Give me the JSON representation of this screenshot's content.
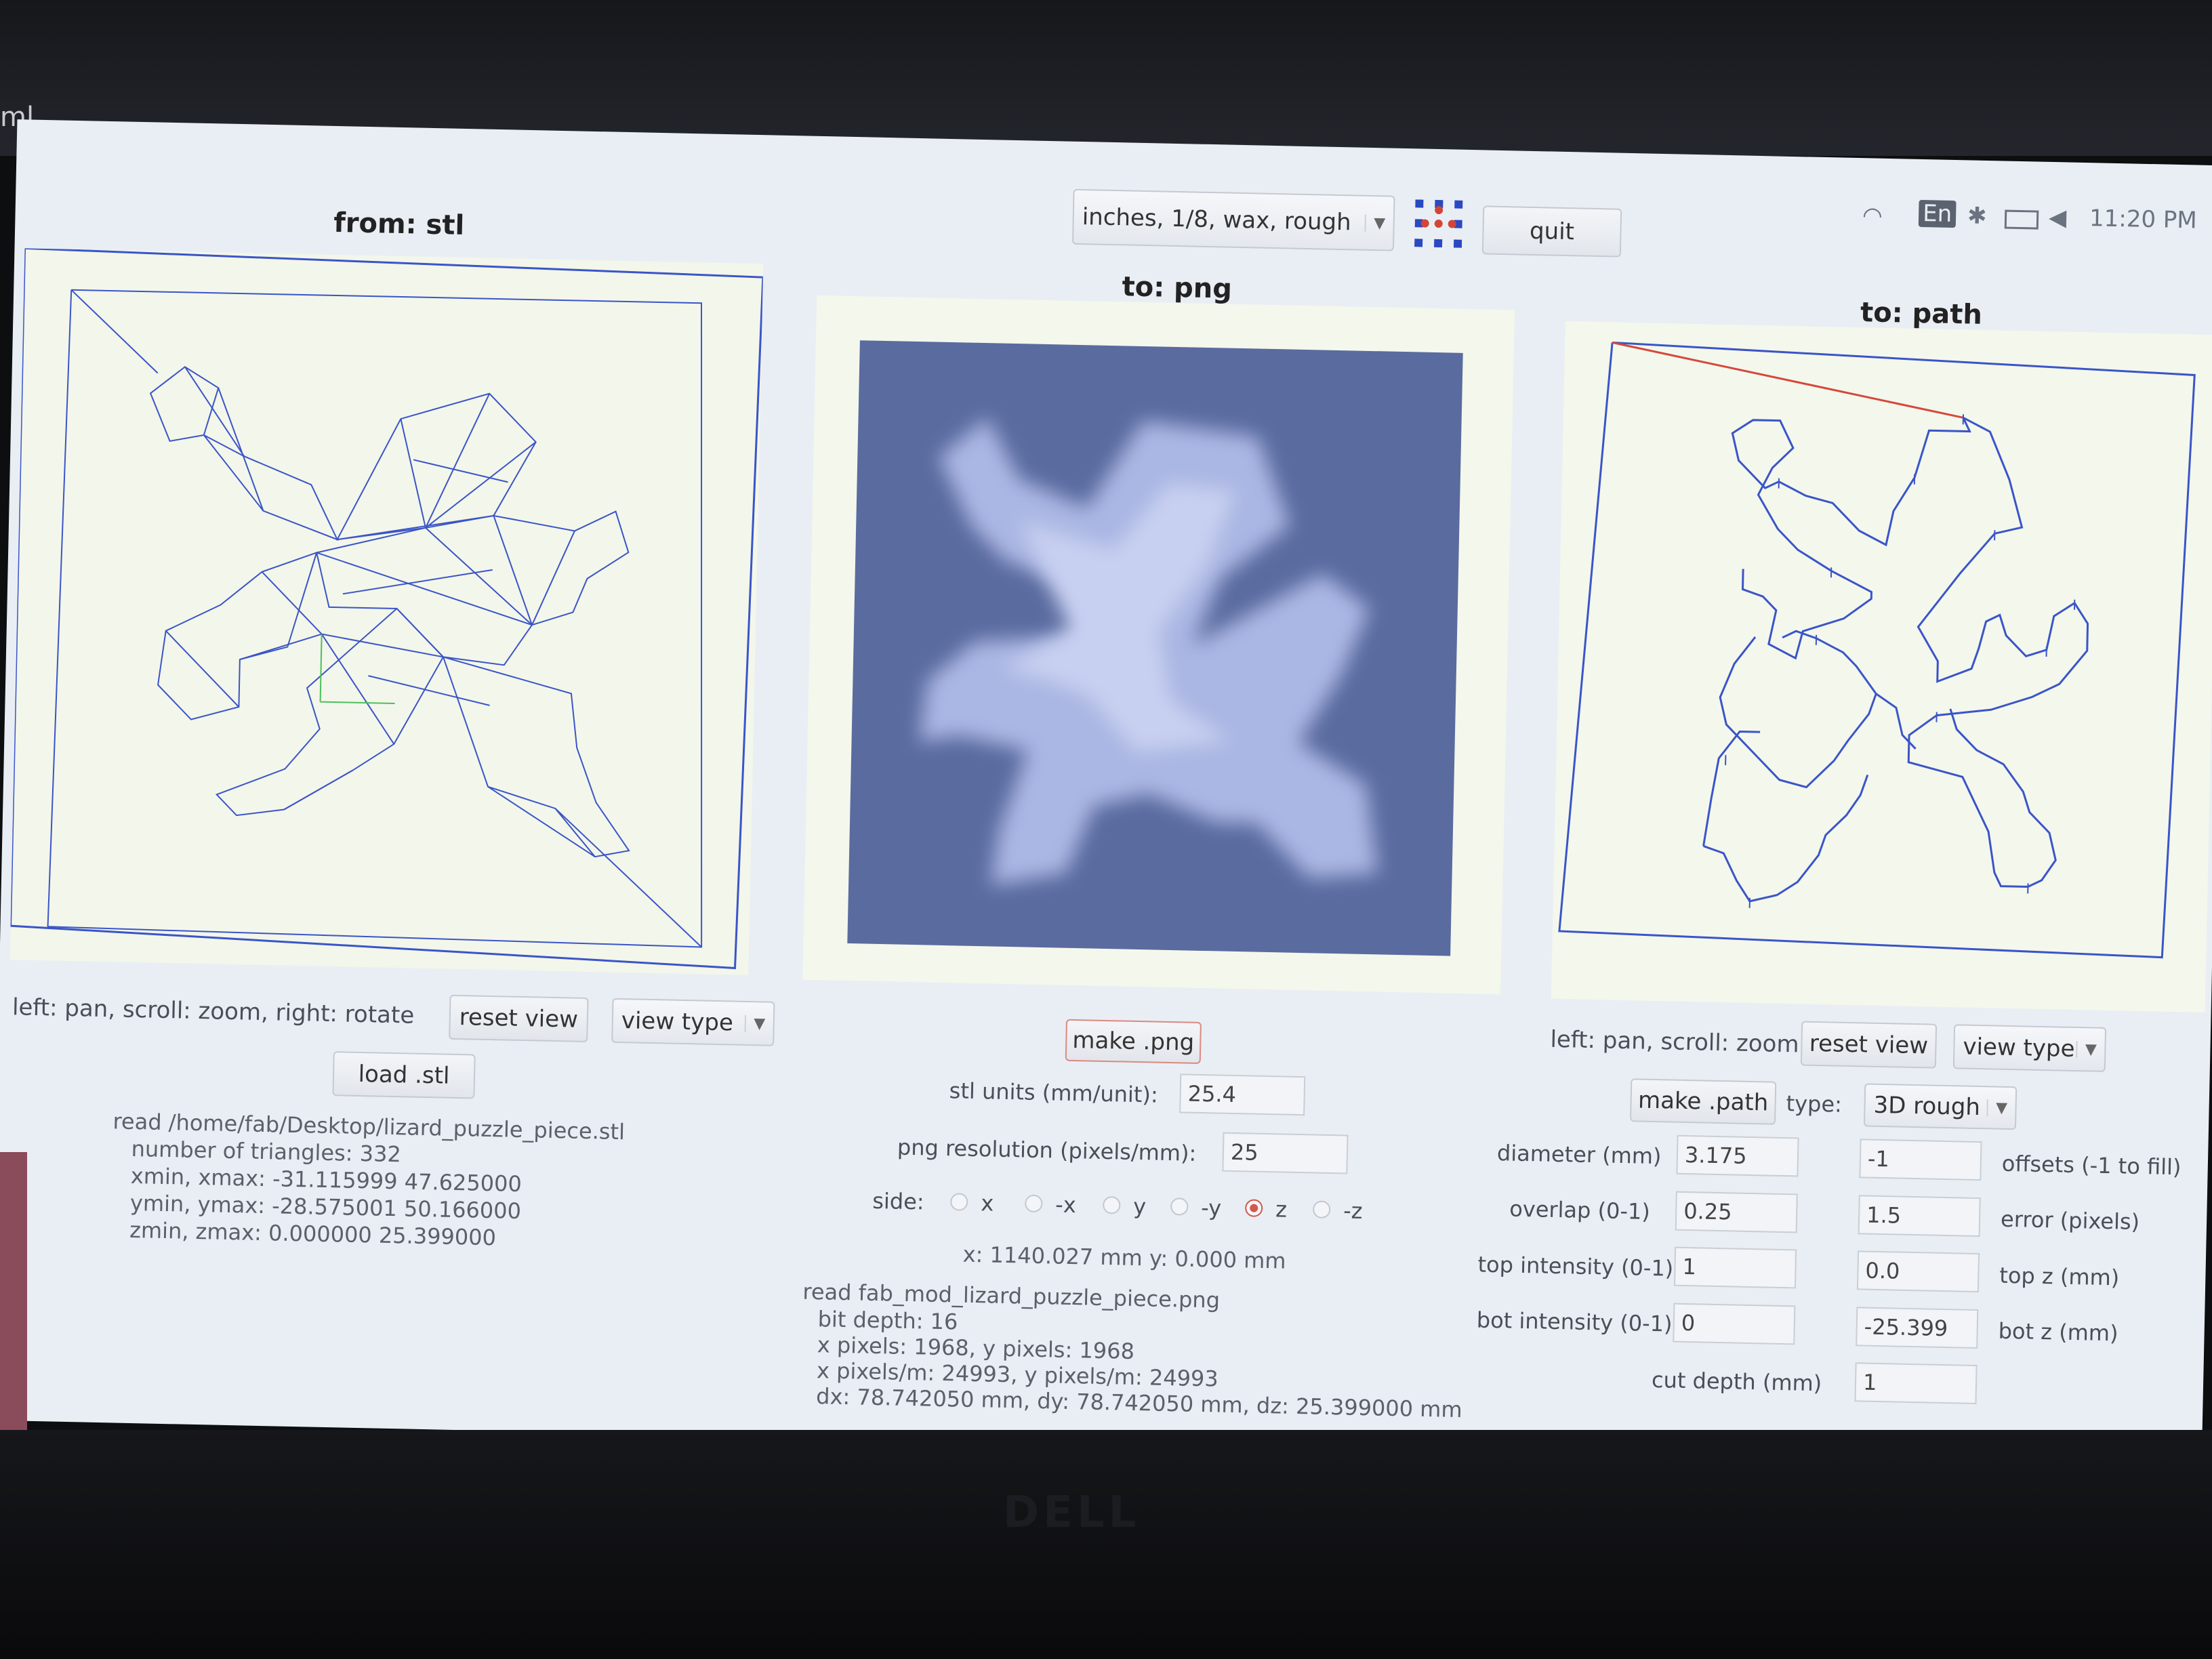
{
  "window": {
    "title_fragment": "ml"
  },
  "system_tray": {
    "language": "En",
    "clock": "11:20 PM"
  },
  "toolbar": {
    "preset_select": "inches, 1/8, wax, rough",
    "quit_label": "quit"
  },
  "stl_panel": {
    "title": "from: stl",
    "hint": "left: pan, scroll: zoom, right: rotate",
    "reset_label": "reset view",
    "view_type_label": "view type",
    "load_label": "load .stl",
    "info": [
      "read /home/fab/Desktop/lizard_puzzle_piece.stl",
      "number of triangles: 332",
      "xmin, xmax: -31.115999 47.625000",
      "ymin, ymax: -28.575001 50.166000",
      "zmin, zmax: 0.000000 25.399000"
    ]
  },
  "png_panel": {
    "title": "to: png",
    "make_label": "make .png",
    "stl_units_label": "stl units (mm/unit):",
    "stl_units_value": "25.4",
    "resolution_label": "png resolution (pixels/mm):",
    "resolution_value": "25",
    "side_label": "side:",
    "sides": [
      "x",
      "-x",
      "y",
      "-y",
      "z",
      "-z"
    ],
    "selected_side": "z",
    "coords": "x: 1140.027 mm  y: 0.000 mm",
    "info": [
      "read fab_mod_lizard_puzzle_piece.png",
      "bit depth: 16",
      "x pixels: 1968, y pixels: 1968",
      "x pixels/m: 24993, y pixels/m: 24993",
      "dx: 78.742050 mm, dy: 78.742050 mm, dz: 25.399000 mm"
    ]
  },
  "path_panel": {
    "title": "to: path",
    "hint": "left: pan, scroll: zoom",
    "reset_label": "reset view",
    "view_type_label": "view type",
    "make_label": "make .path",
    "type_label": "type:",
    "type_value": "3D rough",
    "diameter_label": "diameter (mm)",
    "diameter_value": "3.175",
    "offsets_value": "-1",
    "offsets_label": "offsets (-1 to fill)",
    "overlap_label": "overlap (0-1)",
    "overlap_value": "0.25",
    "error_value": "1.5",
    "error_label": "error (pixels)",
    "top_intensity_label": "top intensity (0-1)",
    "top_intensity_value": "1",
    "top_z_value": "0.0",
    "top_z_label": "top z (mm)",
    "bot_intensity_label": "bot intensity (0-1)",
    "bot_intensity_value": "0",
    "bot_z_value": "-25.399",
    "bot_z_label": "bot z (mm)",
    "cut_depth_label": "cut depth (mm)",
    "cut_depth_value": "1"
  },
  "colors": {
    "wireframe": "#3a55c8",
    "toolpath_move": "#d6473c",
    "png_bg": "#5a6b9f"
  }
}
